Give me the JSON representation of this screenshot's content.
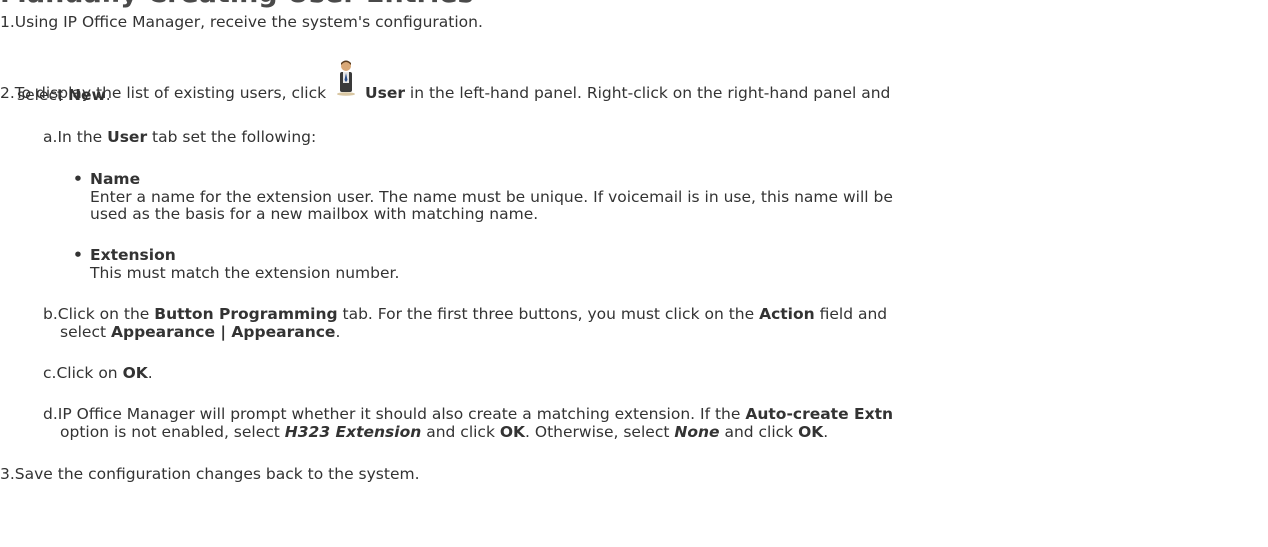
{
  "heading": "Manually Creating User Entries",
  "steps": [
    {
      "num": "1.",
      "text": "Using IP Office Manager, receive the system's configuration."
    },
    {
      "num": "2.",
      "pre": "To display the list of existing users, click",
      "icon": "user-icon",
      "bold": "User",
      "post": " in the left-hand panel. Right-click on the right-hand panel and",
      "line2_pre": "select ",
      "line2_bold": "New",
      "line2_post": "."
    },
    {
      "num": "3.",
      "text": "Save the configuration changes back to the system."
    }
  ],
  "substeps": {
    "a": {
      "num": "a.",
      "pre": "In the ",
      "bold": "User",
      "post": " tab set the following:",
      "bullets": [
        {
          "title": "Name",
          "lines": [
            "Enter a name for the extension user. The name must be unique. If voicemail is in use, this name will be",
            "used as the basis for a new mailbox with matching name."
          ]
        },
        {
          "title": "Extension",
          "lines": [
            "This must match the extension number."
          ]
        }
      ]
    },
    "b": {
      "num": "b.",
      "t1": "Click on the ",
      "b1": "Button Programming",
      "t2": " tab. For the first three buttons, you must click on the ",
      "b2": "Action",
      "t3": " field and",
      "t4": "select ",
      "b3": "Appearance | Appearance",
      "t5": "."
    },
    "c": {
      "num": "c.",
      "t1": "Click on ",
      "b1": "OK",
      "t2": "."
    },
    "d": {
      "num": "d.",
      "t1": "IP Office Manager will prompt whether it should also create a matching extension. If the ",
      "b1": "Auto-create Extn",
      "t2": "option is not enabled, select ",
      "bi1": "H323 Extension",
      "t3": " and click ",
      "b2": "OK",
      "t4": ". Otherwise, select ",
      "bi2": "None",
      "t5": " and click ",
      "b3": "OK",
      "t6": "."
    }
  }
}
